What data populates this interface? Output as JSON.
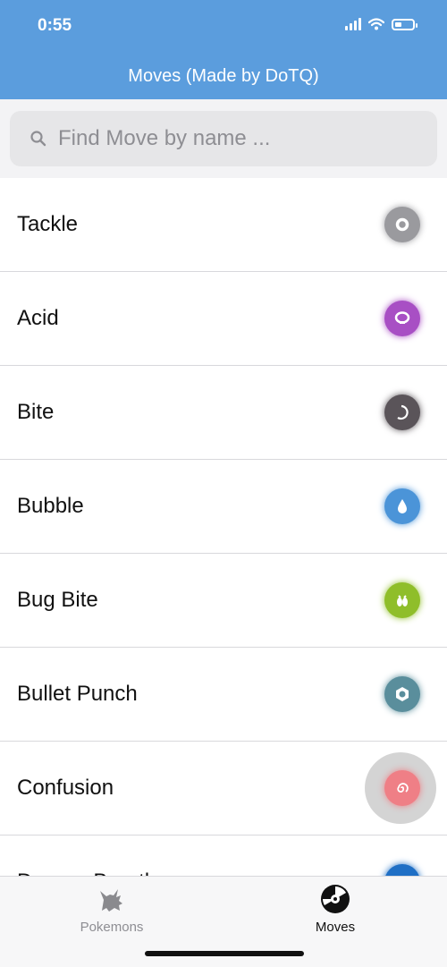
{
  "status_bar": {
    "time": "0:55"
  },
  "header": {
    "title": "Moves (Made by DoTQ)"
  },
  "search": {
    "placeholder": "Find Move by name ..."
  },
  "moves": [
    {
      "name": "Tackle",
      "type_icon": "normal-type-icon",
      "color": "#9a9a9e"
    },
    {
      "name": "Acid",
      "type_icon": "poison-type-icon",
      "color": "#a84fc4"
    },
    {
      "name": "Bite",
      "type_icon": "dark-type-icon",
      "color": "#5a5459"
    },
    {
      "name": "Bubble",
      "type_icon": "water-type-icon",
      "color": "#4b94d8"
    },
    {
      "name": "Bug Bite",
      "type_icon": "bug-type-icon",
      "color": "#8fbe2a"
    },
    {
      "name": "Bullet Punch",
      "type_icon": "steel-type-icon",
      "color": "#5a8e9c"
    },
    {
      "name": "Confusion",
      "type_icon": "psychic-type-icon",
      "color": "#ef7f86"
    },
    {
      "name": "Dragon Breath",
      "type_icon": "dragon-type-icon",
      "color": "#1f6fc5"
    }
  ],
  "tabs": [
    {
      "label": "Pokemons",
      "icon": "pikachu-icon",
      "active": false
    },
    {
      "label": "Moves",
      "icon": "disc-icon",
      "active": true
    }
  ],
  "colors": {
    "header": "#5b9ddd",
    "tab_active": "#111111",
    "tab_inactive": "#8e8e93"
  }
}
